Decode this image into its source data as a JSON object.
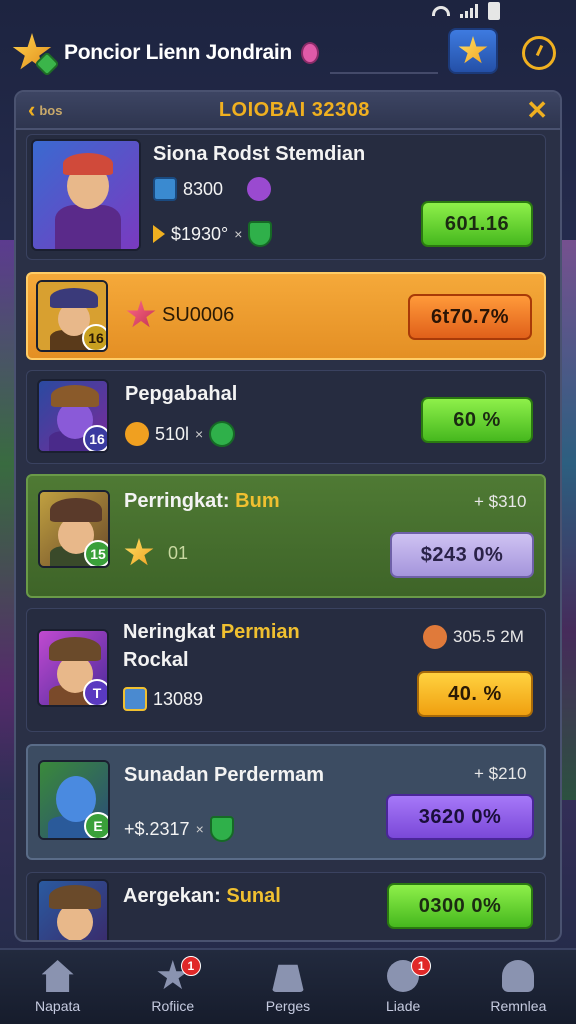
{
  "status": {
    "icons": [
      "wifi-icon",
      "signal-icon",
      "battery-icon"
    ]
  },
  "header": {
    "app_title": "Poncior Lienn Jondrain",
    "icons": [
      "app-logo-icon",
      "star-icon",
      "clock-icon"
    ]
  },
  "panel": {
    "back_label": "bos",
    "title": "LOIOBAI 32308",
    "close_symbol": "✕"
  },
  "rows": [
    {
      "name": "Siona Rodst Stemdian",
      "stat1": "8300",
      "stat2": "$1930°",
      "stat2_suffix": "×",
      "button": "601.16",
      "style": "dark",
      "button_color": "green"
    },
    {
      "name": "",
      "stat1": "SU0006",
      "stat2": "",
      "level": "16",
      "button": "6t70.7%",
      "style": "orange",
      "button_color": "orange"
    },
    {
      "name": "Pepgabahal",
      "stat1": "510l",
      "stat1_suffix": "×",
      "level": "16",
      "button": "60 %",
      "style": "dark",
      "button_color": "green"
    },
    {
      "name_prefix": "Perringkat: ",
      "name_highlight": "Bum",
      "stat1": "01",
      "level": "15",
      "side_value": "+ $310",
      "button": "$243 0%",
      "style": "green",
      "button_color": "lav"
    },
    {
      "name_prefix": "Neringkat ",
      "name_highlight": "Permian",
      "name_line2": "Rockal",
      "stat1": "13089",
      "level": "T",
      "side_value": "305.5 2M",
      "button": "40. %",
      "style": "dark",
      "button_color": "yellow"
    },
    {
      "name": "Sunadan Perdermam",
      "stat1": "+$.2317",
      "stat1_suffix": "×",
      "level": "E",
      "side_value": "+ $210",
      "button": "3620 0%",
      "style": "steel",
      "button_color": "purple"
    },
    {
      "name_prefix": "Aergekan: ",
      "name_highlight": "Sunal",
      "stat1": "",
      "button": "0300 0%",
      "style": "dark",
      "button_color": "green"
    }
  ],
  "nav": [
    {
      "label": "Napata",
      "icon": "home-icon",
      "badge": ""
    },
    {
      "label": "Rofiice",
      "icon": "star-icon",
      "badge": "1"
    },
    {
      "label": "Perges",
      "icon": "bag-icon",
      "badge": ""
    },
    {
      "label": "Liade",
      "icon": "rocket-icon",
      "badge": "1"
    },
    {
      "label": "Remnlea",
      "icon": "user-icon",
      "badge": ""
    }
  ]
}
